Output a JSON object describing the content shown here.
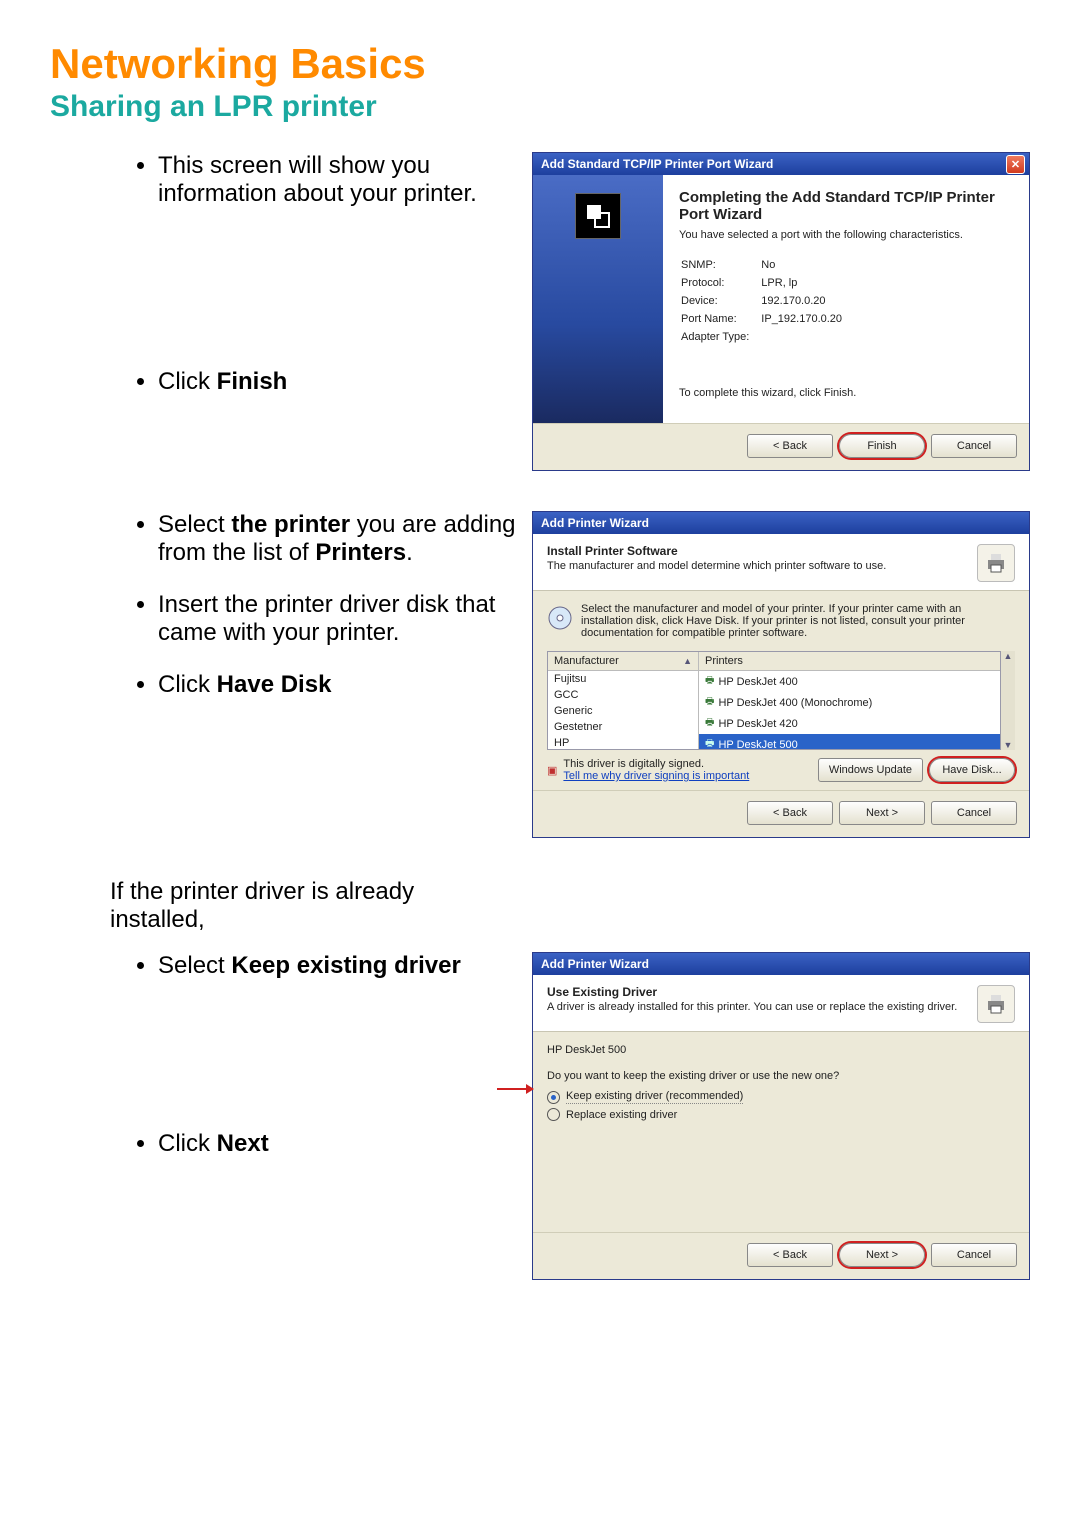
{
  "page": {
    "title": "Networking Basics",
    "subtitle": "Sharing an LPR printer"
  },
  "instructions": {
    "step1_a": "This screen will show you information about your printer.",
    "step1_b_pre": "Click ",
    "step1_b_bold": "Finish",
    "step2_a_pre": "Select ",
    "step2_a_bold": "the printer",
    "step2_a_post": " you are adding from the list of ",
    "step2_a_bold2": "Printers",
    "step2_a_end": ".",
    "step2_b": "Insert the printer driver disk that came with your printer.",
    "step2_c_pre": "Click ",
    "step2_c_bold": "Have Disk",
    "middle": "If the printer driver is already installed,",
    "step3_a_pre": "Select ",
    "step3_a_bold": "Keep existing driver",
    "step3_b_pre": "Click ",
    "step3_b_bold": "Next"
  },
  "dlg1": {
    "title": "Add Standard TCP/IP Printer Port Wizard",
    "heading": "Completing the Add Standard TCP/IP Printer Port Wizard",
    "sub": "You have selected a port with the following characteristics.",
    "rows": {
      "snmp_l": "SNMP:",
      "snmp_v": "No",
      "proto_l": "Protocol:",
      "proto_v": "LPR, lp",
      "dev_l": "Device:",
      "dev_v": "192.170.0.20",
      "port_l": "Port Name:",
      "port_v": "IP_192.170.0.20",
      "adap_l": "Adapter Type:",
      "adap_v": ""
    },
    "footer_text": "To complete this wizard, click Finish.",
    "back": "< Back",
    "finish": "Finish",
    "cancel": "Cancel"
  },
  "dlg2": {
    "title": "Add Printer Wizard",
    "heading": "Install Printer Software",
    "sub": "The manufacturer and model determine which printer software to use.",
    "instr": "Select the manufacturer and model of your printer. If your printer came with an installation disk, click Have Disk. If your printer is not listed, consult your printer documentation for compatible printer software.",
    "manu_h": "Manufacturer",
    "prn_h": "Printers",
    "manufacturers": [
      "Fujitsu",
      "GCC",
      "Generic",
      "Gestetner",
      "HP"
    ],
    "printers": {
      "p1": "HP DeskJet 400",
      "p2": "HP DeskJet 400 (Monochrome)",
      "p3": "HP DeskJet 420",
      "p4": "HP DeskJet 500"
    },
    "signed": "This driver is digitally signed.",
    "why": "Tell me why driver signing is important",
    "wu": "Windows Update",
    "hd": "Have Disk...",
    "back": "< Back",
    "next": "Next >",
    "cancel": "Cancel"
  },
  "dlg3": {
    "title": "Add Printer Wizard",
    "heading": "Use Existing Driver",
    "sub": "A driver is already installed for this printer. You can use or replace the existing driver.",
    "model": "HP DeskJet 500",
    "question": "Do you want to keep the existing driver or use the new one?",
    "opt1": "Keep existing driver (recommended)",
    "opt2": "Replace existing driver",
    "back": "< Back",
    "next": "Next >",
    "cancel": "Cancel"
  }
}
